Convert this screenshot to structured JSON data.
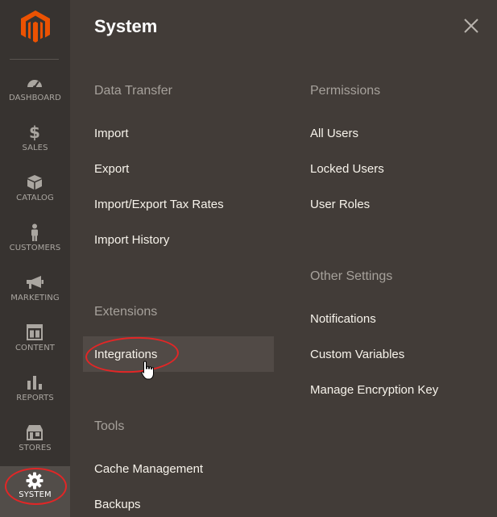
{
  "sidebar": {
    "items": [
      {
        "key": "dashboard",
        "label": "DASHBOARD",
        "icon": "dashboard-icon"
      },
      {
        "key": "sales",
        "label": "SALES",
        "icon": "dollar-icon"
      },
      {
        "key": "catalog",
        "label": "CATALOG",
        "icon": "box-icon"
      },
      {
        "key": "customers",
        "label": "CUSTOMERS",
        "icon": "person-icon"
      },
      {
        "key": "marketing",
        "label": "MARKETING",
        "icon": "megaphone-icon"
      },
      {
        "key": "content",
        "label": "CONTENT",
        "icon": "layout-icon"
      },
      {
        "key": "reports",
        "label": "REPORTS",
        "icon": "bar-chart-icon"
      },
      {
        "key": "stores",
        "label": "STORES",
        "icon": "store-icon"
      },
      {
        "key": "system",
        "label": "SYSTEM",
        "icon": "gear-icon",
        "active": true
      }
    ]
  },
  "panel": {
    "title": "System",
    "close_icon": "close-icon",
    "sections": {
      "data_transfer": {
        "title": "Data Transfer",
        "items": [
          "Import",
          "Export",
          "Import/Export Tax Rates",
          "Import History"
        ]
      },
      "extensions": {
        "title": "Extensions",
        "items": [
          "Integrations"
        ]
      },
      "tools": {
        "title": "Tools",
        "items": [
          "Cache Management",
          "Backups"
        ]
      },
      "permissions": {
        "title": "Permissions",
        "items": [
          "All Users",
          "Locked Users",
          "User Roles"
        ]
      },
      "other_settings": {
        "title": "Other Settings",
        "items": [
          "Notifications",
          "Custom Variables",
          "Manage Encryption Key"
        ]
      }
    }
  },
  "colors": {
    "sidebar_bg": "#373330",
    "panel_bg": "#423c38",
    "logo_orange": "#eb5202",
    "annotation_red": "#e22626"
  }
}
